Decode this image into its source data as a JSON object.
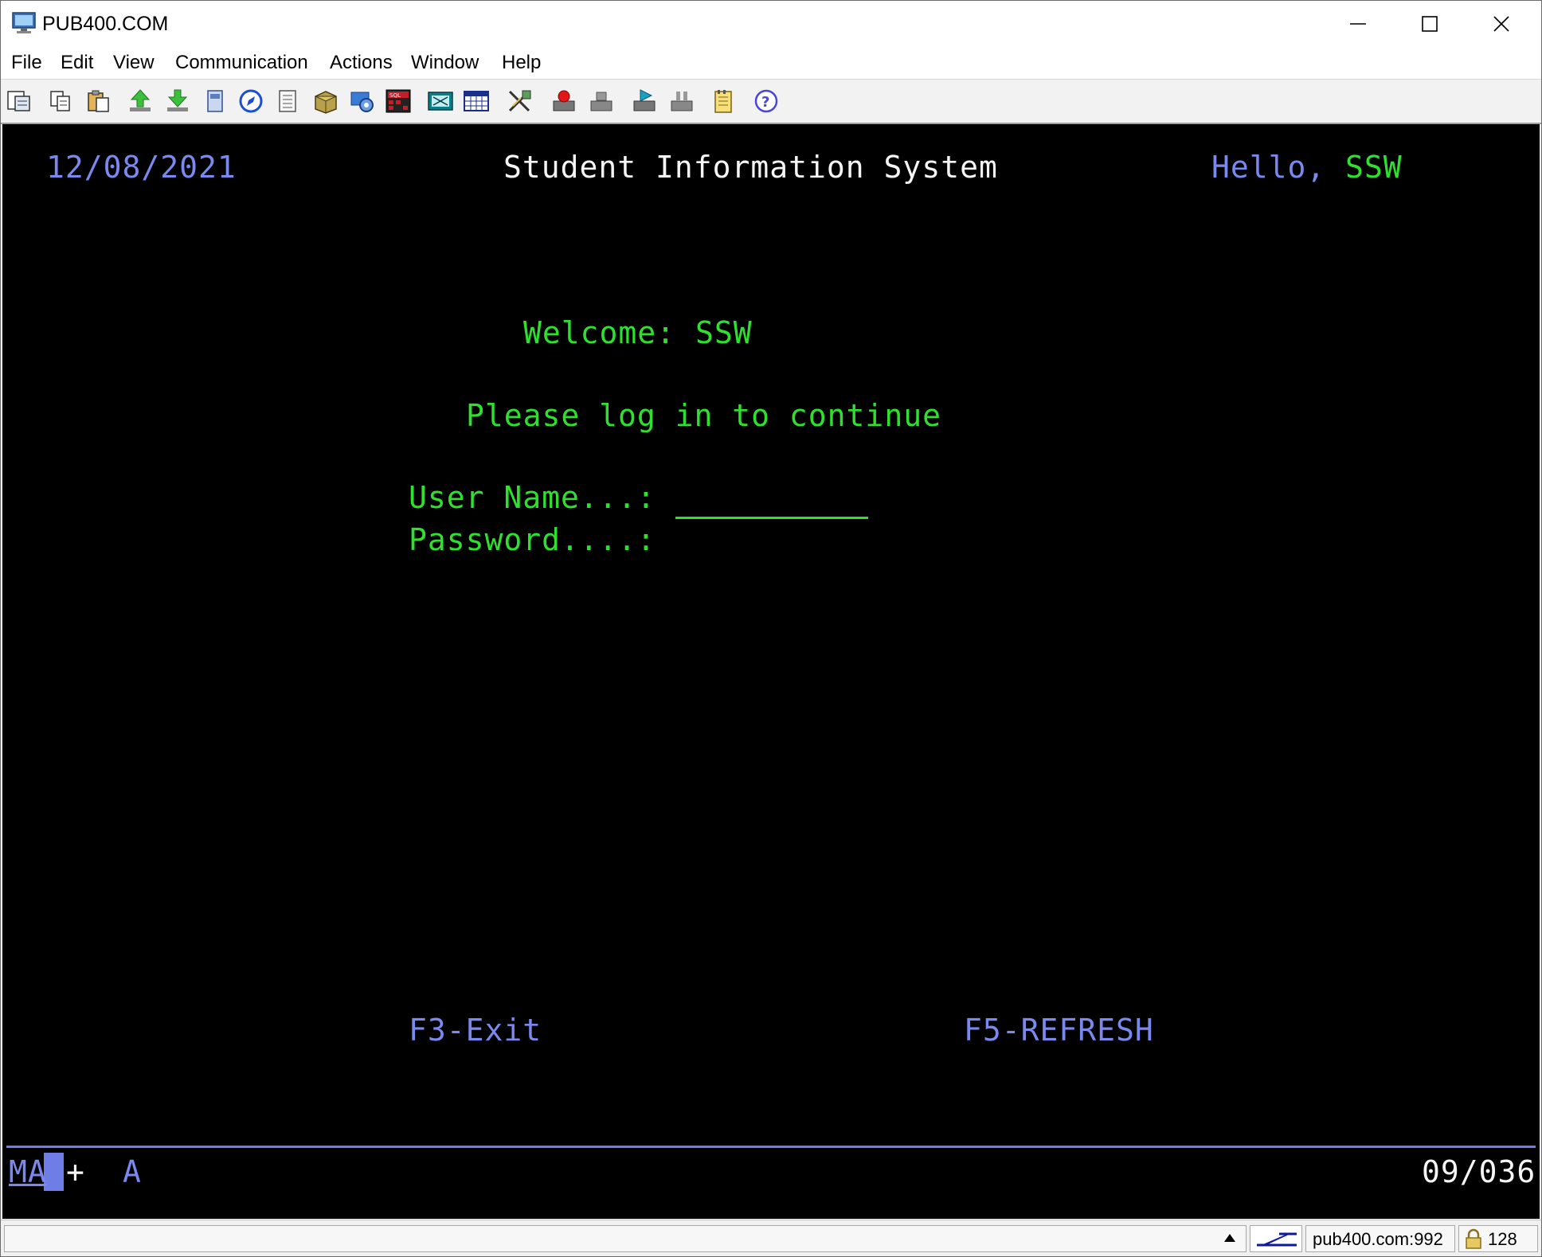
{
  "window": {
    "title": "PUB400.COM"
  },
  "menu": [
    "File",
    "Edit",
    "View",
    "Communication",
    "Actions",
    "Window",
    "Help"
  ],
  "toolbar_icons": [
    "print-screen-icon",
    "copy-icon",
    "paste-icon",
    "send-file-icon",
    "receive-file-icon",
    "display-icon",
    "navigator-icon",
    "print-icon",
    "data-transfer-icon",
    "settings-icon",
    "sql-icon",
    "keyboard-map-icon",
    "grid-icon",
    "macro-edit-icon",
    "record-macro-icon",
    "stop-macro-icon",
    "play-macro-icon",
    "pause-macro-icon",
    "notes-icon",
    "help-icon"
  ],
  "screen": {
    "date": "12/08/2021",
    "system_title": "Student Information System",
    "hello_label": "Hello,",
    "hello_user": "SSW",
    "welcome_label": "Welcome:",
    "welcome_user": "SSW",
    "login_prompt": "Please log in to continue",
    "username_label": "User Name...:",
    "password_label": "Password....:",
    "f3_label": "F3-Exit",
    "f5_label": "F5-REFRESH"
  },
  "oia": {
    "mode": "MA",
    "indicator": "+",
    "shift": "A",
    "cursor_position": "09/036"
  },
  "status_bar": {
    "host": "pub400.com:992",
    "encryption": "128"
  },
  "colors": {
    "screen_bg": "#000000",
    "green": "#2fe02f",
    "blue": "#7b88ee",
    "white": "#f5f5f5"
  }
}
